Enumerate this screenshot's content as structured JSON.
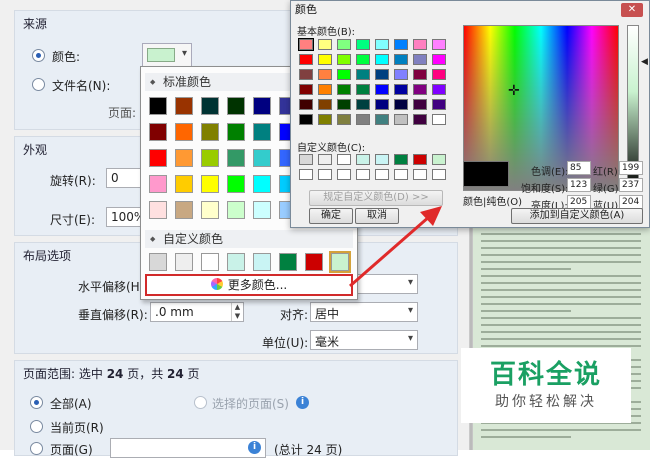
{
  "props": {
    "source": {
      "title": "来源",
      "color_label": "颜色:",
      "file_label": "文件名(N):",
      "page_label": "页面:"
    },
    "appearance": {
      "title": "外观",
      "rotate_label": "旋转(R):",
      "rotate_value": "0",
      "size_label": "尺寸(E):",
      "size_value": "100%"
    },
    "layout": {
      "title": "布局选项",
      "h_offset_label": "水平偏移(H)",
      "v_offset_label": "垂直偏移(R):",
      "v_offset_value": ".0 mm",
      "align_label": "对齐:",
      "align_value": "居中",
      "unit_label": "单位(U):",
      "unit_value": "毫米"
    },
    "range": {
      "title_prefix": "页面范围: 选中 ",
      "selected": "24",
      "title_mid": " 页，共 ",
      "total": "24",
      "title_suffix": " 页",
      "all_label": "全部(A)",
      "selected_pages_label": "选择的页面(S)",
      "current_label": "当前页(R)",
      "pages_label": "页面(G)",
      "pages_total": "(总计 24 页)"
    }
  },
  "popup": {
    "standard_title": "标准颜色",
    "custom_title": "自定义颜色",
    "more_label": "更多颜色...",
    "standard_colors": [
      "#000000",
      "#993300",
      "#003333",
      "#003300",
      "#000080",
      "#333399",
      "#800000",
      "#ff6600",
      "#808000",
      "#008000",
      "#008080",
      "#0000ff",
      "#ff0000",
      "#ff9933",
      "#99cc00",
      "#339966",
      "#33cccc",
      "#3366ff",
      "#ff99cc",
      "#ffcc00",
      "#ffff00",
      "#00ff00",
      "#00ffff",
      "#00ccff",
      "#ffe0e0",
      "#c8a882",
      "#ffffcc",
      "#ccffcc",
      "#ccffff",
      "#99ccff"
    ],
    "custom_colors": [
      "#d8d8d8",
      "#eeeeee",
      "#ffffff",
      "#c9f2e8",
      "#c9f4f4",
      "#008040",
      "#cc0000",
      "#c9f2cf"
    ]
  },
  "color_dialog": {
    "title": "颜色",
    "basic_label": "基本颜色(B):",
    "custom_label": "自定义颜色(C):",
    "define_label": "规定自定义颜色(D) >>",
    "ok_label": "确定",
    "cancel_label": "取消",
    "solid_label": "颜色|纯色(O)",
    "add_label": "添加到自定义颜色(A)",
    "hue_label": "色调(E):",
    "hue": "85",
    "sat_label": "饱和度(S):",
    "sat": "123",
    "lum_label": "亮度(L):",
    "lum": "205",
    "red_label": "红(R):",
    "red": "199",
    "green_label": "绿(G):",
    "green": "237",
    "blue_label": "蓝(U):",
    "blue": "204",
    "basic_colors": [
      "#ff8080",
      "#ffff80",
      "#80ff80",
      "#00ff80",
      "#80ffff",
      "#0080ff",
      "#ff80c0",
      "#ff80ff",
      "#ff0000",
      "#ffff00",
      "#80ff00",
      "#00ff40",
      "#00ffff",
      "#0080c0",
      "#8080c0",
      "#ff00ff",
      "#804040",
      "#ff8040",
      "#00ff00",
      "#008080",
      "#004080",
      "#8080ff",
      "#800040",
      "#ff0080",
      "#800000",
      "#ff8000",
      "#008000",
      "#008040",
      "#0000ff",
      "#0000a0",
      "#800080",
      "#8000ff",
      "#400000",
      "#804000",
      "#004000",
      "#004040",
      "#000080",
      "#000040",
      "#400040",
      "#400080",
      "#000000",
      "#808000",
      "#808040",
      "#808080",
      "#408080",
      "#c0c0c0",
      "#400040",
      "#ffffff"
    ],
    "custom_colors": [
      "#d8d8d8",
      "#eeeeee",
      "#ffffff",
      "#c9f2e8",
      "#c9f4f4",
      "#008040",
      "#cc0000",
      "#c9f2cf",
      "#ffffff",
      "#ffffff",
      "#ffffff",
      "#ffffff",
      "#ffffff",
      "#ffffff",
      "#ffffff",
      "#ffffff"
    ]
  },
  "watermark": {
    "big": "百科全说",
    "small": "助你轻松解决"
  }
}
